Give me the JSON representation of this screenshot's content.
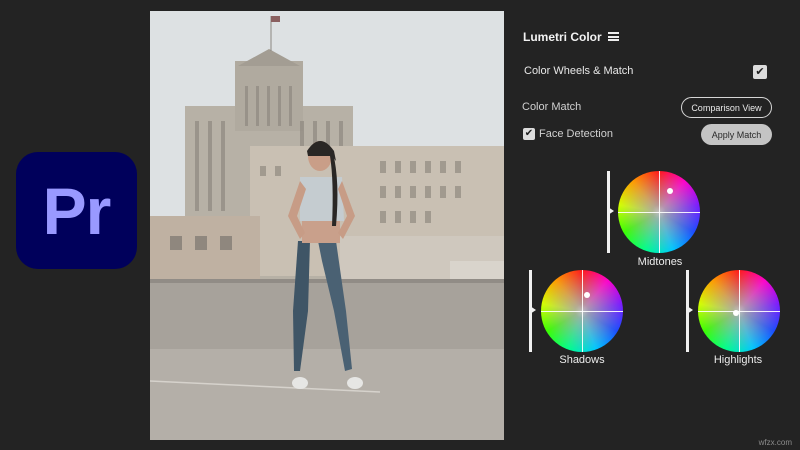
{
  "logo": {
    "text": "Pr",
    "colors": {
      "background": "#00005b",
      "text": "#9999ff"
    }
  },
  "panel": {
    "title": "Lumetri Color",
    "section_label": "Color Wheels & Match",
    "section_checked": true,
    "color_match_label": "Color Match",
    "comparison_button": "Comparison View",
    "face_detection_label": "Face Detection",
    "face_detection_checked": true,
    "apply_button": "Apply Match"
  },
  "wheels": [
    {
      "name": "midtones",
      "label": "Midtones"
    },
    {
      "name": "shadows",
      "label": "Shadows"
    },
    {
      "name": "highlights",
      "label": "Highlights"
    }
  ],
  "icons": {
    "menu": "hamburger-menu-icon",
    "check": "✔"
  },
  "watermark": "wfzx.com"
}
